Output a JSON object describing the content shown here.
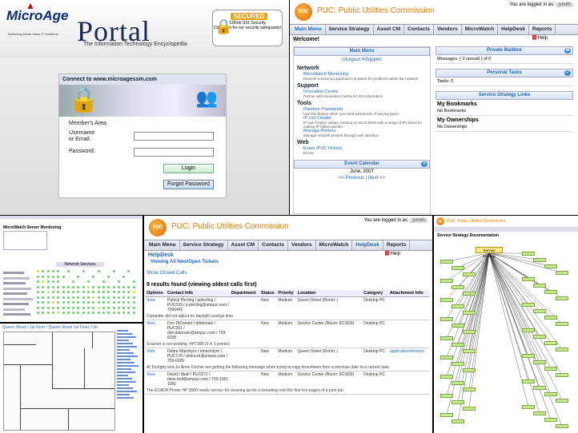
{
  "login": {
    "brand": "MicroAge",
    "brand_tagline": "Delivering World Class IT Solutions",
    "portal_title": "Portal",
    "portal_subtitle": "The Information Technology Encyclopedia",
    "secured_badge": "SECURED",
    "ssl_label": "128-bit SSL Security",
    "ssl_note": "Click here for our security safeguards!",
    "connect_title": "Connect to www.microagessm.com",
    "members_area": "Member's Area",
    "username_label": "Username",
    "username_label_2": "or Email:",
    "password_label": "Password:",
    "login_button": "Login",
    "forgot_button": "Forgot Password"
  },
  "puc": {
    "logo_text": "PUC",
    "title": "PUC: Public Utilities Commission",
    "logged_in_as": "You are logged in as:",
    "username": "jsmith",
    "nav": [
      "Main Menu",
      "Service Strategy",
      "Asset CM",
      "Contacts",
      "Vendors",
      "MicroWatch",
      "HelpDesk",
      "Reports"
    ]
  },
  "main": {
    "welcome": "Welcome!",
    "help": "Help",
    "main_menu_bar": "Main Menu",
    "logout": "Logout",
    "support": "Support",
    "sections": [
      {
        "title": "Network",
        "items": [
          {
            "label": "MicroWatch Monitoring",
            "desc": "Network monitoring application to watch for problems within the network."
          }
        ]
      },
      {
        "title": "Support",
        "items": [
          {
            "label": "Innovation Centre",
            "desc": "Partner with Innovation Centre for ISS information"
          }
        ]
      },
      {
        "title": "Tools",
        "items": [
          {
            "label": "Random Passwords",
            "desc": "Use this feature when you need passwords of varying types."
          },
          {
            "label": "IP List Creator",
            "desc": "IP List Creator: allows creating an excel sheet with a range of IPs listed for making IP tables quicker."
          },
          {
            "label": "Manage Printers",
            "desc": "Manage network printers through web interface."
          }
        ]
      },
      {
        "title": "Web",
        "items": [
          {
            "label": "Ecare (PUC Online)",
            "desc": "ECare"
          }
        ]
      }
    ],
    "event_calendar": "Event Calendar",
    "calendar_month": "June, 2007",
    "calendar_nav": "<< Previous | Next >>",
    "private_mailbox": "Private Mailbox",
    "messages": "Messages: ( 0 unread ) of 0",
    "personal_tasks": "Personal Tasks",
    "tasks": "Tasks: 0",
    "service_strategy_links": "Service Strategy Links",
    "my_bookmarks": "My Bookmarks",
    "no_bookmarks": "No Bookmarks",
    "my_ownerships": "My Ownerships",
    "no_ownerships": "No Ownerships"
  },
  "helpdesk": {
    "title": "HelpDesk",
    "view_all": "Viewing All New/Open Tickets",
    "show_closed": "Show Closed Calls",
    "help": "Help",
    "found": "9 results found (viewing oldest calls first)",
    "columns": [
      "Options",
      "Contact Info",
      "Department",
      "Status",
      "Priority",
      "Location",
      "Category",
      "Attachment Info"
    ],
    "rows": [
      {
        "option": "View",
        "contact": "Patrick Pierling / pplierling / PUC039 / p.pierling@ampuc.com / 7596442",
        "status": "New",
        "priority": "Medium",
        "location": "Queen Street (Room: )",
        "category": "Desktop PC",
        "attach": "",
        "desc": "Computer did not adjust for daylight savings time."
      },
      {
        "option": "View",
        "contact": "Don DiDonato / ddidonato / PUC001 / don.didonato@ampuc.com / 759-6028",
        "status": "New",
        "priority": "Medium",
        "location": "Service Center (Room: ECSD0)",
        "category": "Desktop PC",
        "attach": "",
        "desc": "Scanner is not working. HP7300 (3 in 1 printer)"
      },
      {
        "option": "View",
        "contact": "Debra Macintyre / dmacintyre / PUC170 / debra.m@ampuc.com / 759-6026",
        "status": "New",
        "priority": "Medium",
        "location": "Queen Street (Room: )",
        "category": "Desktop PC",
        "attach": "application/msword",
        "desc": "Al Tourigny and Jo-Anne Fischer are getting the following message when trying to copy timesheets from a previous date to a current date."
      },
      {
        "option": "View",
        "contact": "David / dbell / PUC071 / dave.bell@ampuc.com / 759-1001 1001",
        "status": "New",
        "priority": "Medium",
        "location": "Service Center (Room: ECSD0)",
        "category": "Desktop PC",
        "attach": "",
        "desc": "The ECADA Printer HP 3500 needs service for cleaning as ink is breading onto the first few pages of a print job"
      }
    ]
  },
  "dashboard": {
    "header": "MicroWatch Server Monitoring",
    "group_label": "Network Services"
  },
  "floorplan": {
    "title": "Queen Street / 1st Floor / Queen Street 1st Floor / Lkt"
  },
  "mindmap": {
    "title": "PUC: Public Utilities Commission",
    "header": "Service Strategy Documentation",
    "root": "Service Strategy"
  },
  "colors": {
    "accent": "#e87b00",
    "link": "#2266bb",
    "nav_bg": "#d6dde8"
  }
}
